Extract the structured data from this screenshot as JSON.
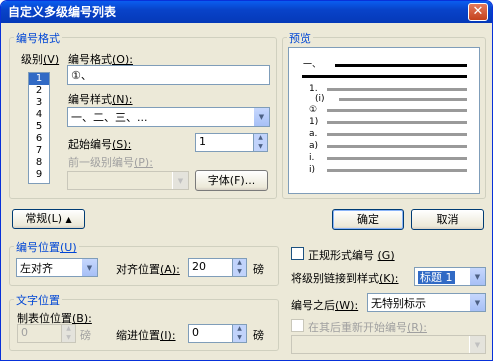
{
  "title": "自定义多级编号列表",
  "close_glyph": "✕",
  "format_group": {
    "legend": "编号格式",
    "level_label": "级别",
    "level_key": "(V)",
    "levels": [
      "1",
      "2",
      "3",
      "4",
      "5",
      "6",
      "7",
      "8",
      "9"
    ],
    "selected_level": "1",
    "format_label": "编号格式",
    "format_key": "(O):",
    "format_value": "①、",
    "style_label": "编号样式",
    "style_key": "(N):",
    "style_value": "一、二、三、...",
    "start_label": "起始编号",
    "start_key": "(S):",
    "start_value": "1",
    "prev_label": "前一级别编号",
    "prev_key": "(P):",
    "prev_value": "",
    "font_button": "字体(F)..."
  },
  "preview_group": {
    "legend": "预览",
    "markers": [
      "一、",
      "1.",
      "(i)",
      "①",
      "1)",
      "a.",
      "a)",
      "i.",
      "i)"
    ]
  },
  "buttons": {
    "normal": "常规(L)",
    "normal_arrow": "▲",
    "ok": "确定",
    "cancel": "取消"
  },
  "position_group": {
    "legend": "编号位置",
    "legend_key": "(U)",
    "align_value": "左对齐",
    "align_pos_label": "对齐位置",
    "align_pos_key": "(A):",
    "align_pos_value": "20",
    "unit": "磅"
  },
  "legal_style": {
    "label": "正规形式编号",
    "key": "(G)",
    "checked": false
  },
  "link_style": {
    "label": "将级别链接到样式",
    "key": "(K):",
    "value": "标题 1"
  },
  "text_group": {
    "legend": "文字位置",
    "tab_label": "制表位位置",
    "tab_key": "(B):",
    "tab_value": "0",
    "tab_unit": "磅",
    "indent_label": "缩进位置",
    "indent_key": "(I):",
    "indent_value": "0",
    "indent_unit": "磅"
  },
  "follow": {
    "label": "编号之后",
    "key": "(W):",
    "value": "无特别标示"
  },
  "restart": {
    "label": "在其后重新开始编号",
    "key": "(R):",
    "checked": false,
    "value": ""
  }
}
